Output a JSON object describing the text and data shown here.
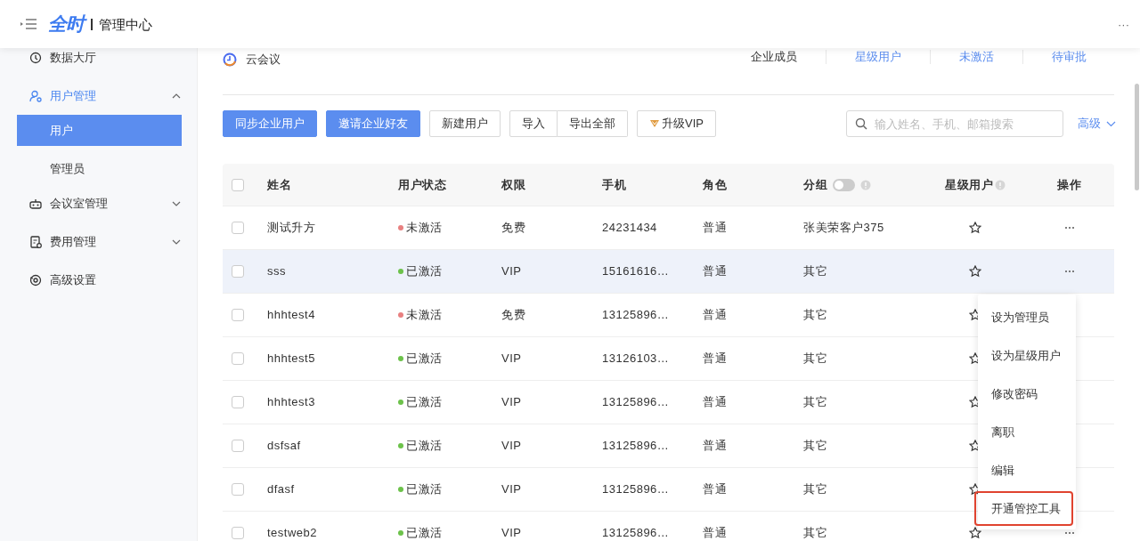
{
  "header": {
    "logo": "全时",
    "title": "管理中心",
    "more": "···"
  },
  "sidebar": {
    "items": [
      {
        "label": "数据大厅",
        "kind": "link",
        "selected": false
      },
      {
        "label": "用户管理",
        "kind": "group",
        "selected": true,
        "expanded": true,
        "children": [
          {
            "label": "用户",
            "selected": true
          },
          {
            "label": "管理员",
            "selected": false
          }
        ]
      },
      {
        "label": "会议室管理",
        "kind": "group",
        "selected": false,
        "expanded": false
      },
      {
        "label": "费用管理",
        "kind": "group",
        "selected": false,
        "expanded": false
      },
      {
        "label": "高级设置",
        "kind": "link",
        "selected": false
      }
    ]
  },
  "product": {
    "name": "云会议"
  },
  "tabs": [
    {
      "label": "企业成员",
      "selected": true
    },
    {
      "label": "星级用户",
      "selected": false
    },
    {
      "label": "未激活",
      "selected": false
    },
    {
      "label": "待审批",
      "selected": false
    }
  ],
  "toolbar": {
    "buttons": [
      {
        "kind": "primary",
        "labels": [
          "同步企业用户"
        ]
      },
      {
        "kind": "primary",
        "labels": [
          "邀请企业好友"
        ]
      },
      {
        "kind": "default",
        "labels": [
          "新建用户"
        ]
      },
      {
        "kind": "split",
        "labels": [
          "导入",
          "导出全部"
        ]
      },
      {
        "kind": "vip",
        "labels": [
          "升级VIP"
        ]
      }
    ],
    "search": {
      "placeholder": "输入姓名、手机、邮箱搜索"
    },
    "advanced": "高级"
  },
  "table": {
    "select_all_checked": false,
    "columns": [
      {
        "label": "姓名",
        "kind": "text"
      },
      {
        "label": "用户状态",
        "kind": "text"
      },
      {
        "label": "权限",
        "kind": "text"
      },
      {
        "label": "手机",
        "kind": "text"
      },
      {
        "label": "角色",
        "kind": "text"
      },
      {
        "label": "分组",
        "kind": "toggle",
        "on": false
      },
      {
        "label": "星级用户",
        "kind": "info"
      },
      {
        "label": "操作",
        "kind": "text"
      }
    ],
    "rows": [
      {
        "checked": false,
        "hovered": false,
        "name": "测试升方",
        "status": "未激活",
        "active": false,
        "permission": "免费",
        "phone": "24231434",
        "role": "普通",
        "group": "张美荣客户375",
        "starred": false
      },
      {
        "checked": false,
        "hovered": true,
        "name": "sss",
        "status": "已激活",
        "active": true,
        "permission": "VIP",
        "phone": "15161616…",
        "role": "普通",
        "group": "其它",
        "starred": false
      },
      {
        "checked": false,
        "hovered": false,
        "name": "hhhtest4",
        "status": "未激活",
        "active": false,
        "permission": "免费",
        "phone": "13125896…",
        "role": "普通",
        "group": "其它",
        "starred": false
      },
      {
        "checked": false,
        "hovered": false,
        "name": "hhhtest5",
        "status": "已激活",
        "active": true,
        "permission": "VIP",
        "phone": "13126103…",
        "role": "普通",
        "group": "其它",
        "starred": false
      },
      {
        "checked": false,
        "hovered": false,
        "name": "hhhtest3",
        "status": "已激活",
        "active": true,
        "permission": "VIP",
        "phone": "13125896…",
        "role": "普通",
        "group": "其它",
        "starred": false
      },
      {
        "checked": false,
        "hovered": false,
        "name": "dsfsaf",
        "status": "已激活",
        "active": true,
        "permission": "VIP",
        "phone": "13125896…",
        "role": "普通",
        "group": "其它",
        "starred": false
      },
      {
        "checked": false,
        "hovered": false,
        "name": "dfasf",
        "status": "已激活",
        "active": true,
        "permission": "VIP",
        "phone": "13125896…",
        "role": "普通",
        "group": "其它",
        "starred": false
      },
      {
        "checked": false,
        "hovered": false,
        "name": "testweb2",
        "status": "已激活",
        "active": true,
        "permission": "VIP",
        "phone": "13125896…",
        "role": "普通",
        "group": "其它",
        "starred": false
      }
    ]
  },
  "row_menu": {
    "open": true,
    "items": [
      {
        "label": "设为管理员",
        "highlighted": false
      },
      {
        "label": "设为星级用户",
        "highlighted": false
      },
      {
        "label": "修改密码",
        "highlighted": false
      },
      {
        "label": "离职",
        "highlighted": false
      },
      {
        "label": "编辑",
        "highlighted": false
      },
      {
        "label": "开通管控工具",
        "highlighted": true
      }
    ]
  }
}
